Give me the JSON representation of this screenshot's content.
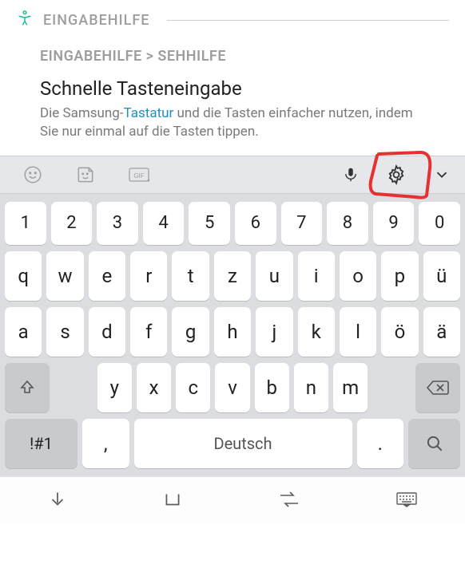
{
  "header": {
    "title": "EINGABEHILFE"
  },
  "breadcrumb": {
    "text": "EINGABEHILFE > SEHHILFE"
  },
  "content": {
    "title": "Schnelle Tasteneingabe",
    "desc_before": "Die Samsung-",
    "desc_link": "Tastatur",
    "desc_after": " und die Tasten einfacher nutzen, indem Sie nur einmal auf die Tasten tippen."
  },
  "toolbar": {
    "emoji_icon": "emoji",
    "sticker_icon": "sticker",
    "gif_icon": "gif",
    "mic_icon": "mic",
    "settings_icon": "settings",
    "expand_icon": "chevron-down"
  },
  "keyboard": {
    "row1": [
      "1",
      "2",
      "3",
      "4",
      "5",
      "6",
      "7",
      "8",
      "9",
      "0"
    ],
    "row2": [
      "q",
      "w",
      "e",
      "r",
      "t",
      "z",
      "u",
      "i",
      "o",
      "p",
      "ü"
    ],
    "row3": [
      "a",
      "s",
      "d",
      "f",
      "g",
      "h",
      "j",
      "k",
      "l",
      "ö",
      "ä"
    ],
    "row4": [
      "y",
      "x",
      "c",
      "v",
      "b",
      "n",
      "m"
    ],
    "sym_label": "!#1",
    "comma": ",",
    "period": ".",
    "space_label": "Deutsch"
  }
}
